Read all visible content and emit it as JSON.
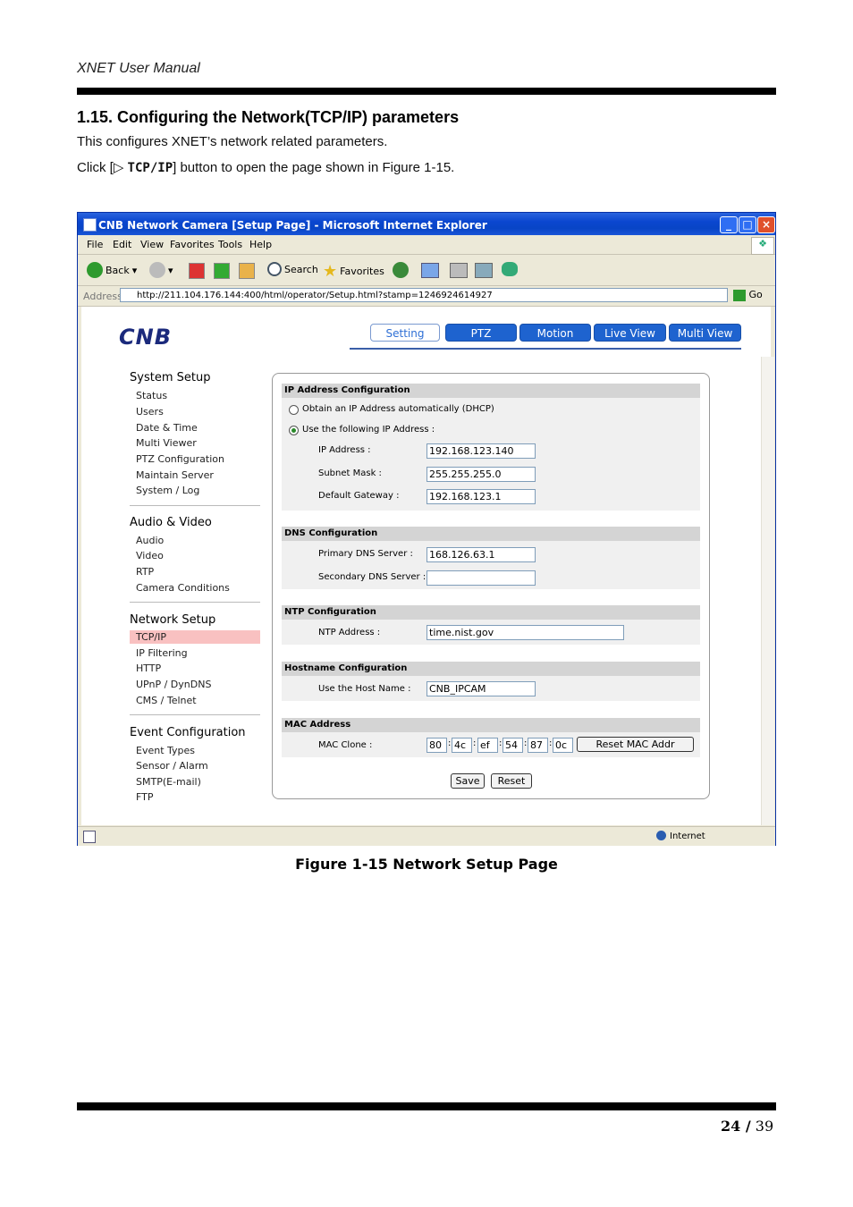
{
  "doc": {
    "header": "XNET User Manual",
    "section_title": "1.15. Configuring the Network(TCP/IP) parameters",
    "para1": "This configures XNET’s network related parameters.",
    "para2_pre": "Click [▷ ",
    "para2_bold": "TCP/IP",
    "para2_post": "] button to open the page shown in Figure 1-15.",
    "caption": "Figure 1-15 Network Setup Page",
    "page_current": "24 /",
    "page_total": " 39"
  },
  "browser": {
    "title": "CNB Network Camera [Setup Page] - Microsoft Internet Explorer",
    "menu": [
      "File",
      "Edit",
      "View",
      "Favorites",
      "Tools",
      "Help"
    ],
    "toolbar": {
      "back": "Back",
      "search": "Search",
      "favorites": "Favorites"
    },
    "address_label": "Address",
    "address_value": "http://211.104.176.144:400/html/operator/Setup.html?stamp=1246924614927",
    "go_label": "Go",
    "status_zone": "Internet"
  },
  "page": {
    "logo": "CNB",
    "tabs": [
      "Setting",
      "PTZ",
      "Motion",
      "Live View",
      "Multi View"
    ],
    "sidebar": {
      "system": {
        "title": "System Setup",
        "items": [
          "Status",
          "Users",
          "Date & Time",
          "Multi Viewer",
          "PTZ Configuration",
          "Maintain Server",
          "System / Log"
        ]
      },
      "av": {
        "title": "Audio & Video",
        "items": [
          "Audio",
          "Video",
          "RTP",
          "Camera Conditions"
        ]
      },
      "network": {
        "title": "Network Setup",
        "items": [
          "TCP/IP",
          "IP Filtering",
          "HTTP",
          "UPnP / DynDNS",
          "CMS / Telnet"
        ]
      },
      "event": {
        "title": "Event Configuration",
        "items": [
          "Event Types",
          "Sensor / Alarm",
          "SMTP(E-mail)",
          "FTP"
        ]
      }
    },
    "ip": {
      "title": "IP Address Configuration",
      "dhcp": "Obtain an IP Address automatically (DHCP)",
      "static": "Use the following IP Address :",
      "ip_label": "IP Address :",
      "ip_value": "192.168.123.140",
      "mask_label": "Subnet Mask :",
      "mask_value": "255.255.255.0",
      "gw_label": "Default Gateway :",
      "gw_value": "192.168.123.1"
    },
    "dns": {
      "title": "DNS Configuration",
      "primary_label": "Primary DNS Server :",
      "primary_value": "168.126.63.1",
      "secondary_label": "Secondary DNS Server :",
      "secondary_value": ""
    },
    "ntp": {
      "title": "NTP Configuration",
      "label": "NTP Address :",
      "value": "time.nist.gov"
    },
    "hostname": {
      "title": "Hostname Configuration",
      "label": "Use the Host Name :",
      "value": "CNB_IPCAM"
    },
    "mac": {
      "title": "MAC Address",
      "label": "MAC Clone :",
      "octets": [
        "80",
        "4c",
        "ef",
        "54",
        "87",
        "0c"
      ],
      "reset_label": "Reset MAC Addr"
    },
    "save_label": "Save",
    "reset_label": "Reset"
  }
}
